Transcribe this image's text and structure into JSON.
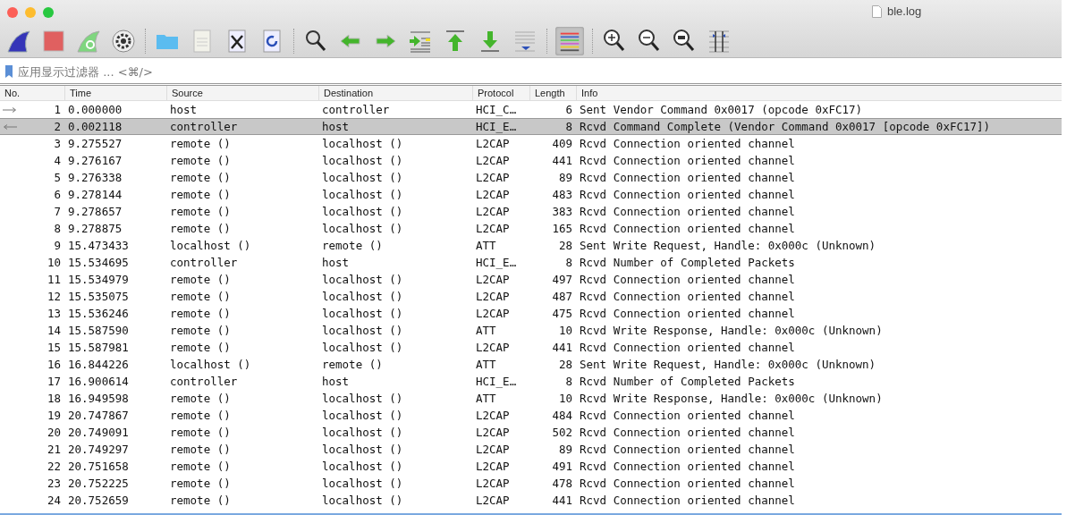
{
  "window": {
    "title": "ble.log"
  },
  "toolbar": {
    "colorize_on": true
  },
  "filter": {
    "placeholder": "应用显示过滤器 ... <⌘/>"
  },
  "table": {
    "columns": [
      "No.",
      "Time",
      "Source",
      "Destination",
      "Protocol",
      "Length",
      "Info"
    ],
    "rows": [
      {
        "cells": [
          "1",
          "0.000000",
          "host",
          "controller",
          "HCI_C…",
          "6",
          "Sent Vendor Command 0x0017 (opcode 0xFC17)"
        ],
        "selected": false,
        "kind": "sent"
      },
      {
        "cells": [
          "2",
          "0.002118",
          "controller",
          "host",
          "HCI_E…",
          "8",
          "Rcvd Command Complete (Vendor Command 0x0017 [opcode 0xFC17])"
        ],
        "selected": true,
        "kind": "received"
      },
      {
        "cells": [
          "3",
          "9.275527",
          "remote ()",
          "localhost ()",
          "L2CAP",
          "409",
          "Rcvd Connection oriented channel"
        ],
        "selected": false
      },
      {
        "cells": [
          "4",
          "9.276167",
          "remote ()",
          "localhost ()",
          "L2CAP",
          "441",
          "Rcvd Connection oriented channel"
        ],
        "selected": false
      },
      {
        "cells": [
          "5",
          "9.276338",
          "remote ()",
          "localhost ()",
          "L2CAP",
          "89",
          "Rcvd Connection oriented channel"
        ],
        "selected": false
      },
      {
        "cells": [
          "6",
          "9.278144",
          "remote ()",
          "localhost ()",
          "L2CAP",
          "483",
          "Rcvd Connection oriented channel"
        ],
        "selected": false
      },
      {
        "cells": [
          "7",
          "9.278657",
          "remote ()",
          "localhost ()",
          "L2CAP",
          "383",
          "Rcvd Connection oriented channel"
        ],
        "selected": false
      },
      {
        "cells": [
          "8",
          "9.278875",
          "remote ()",
          "localhost ()",
          "L2CAP",
          "165",
          "Rcvd Connection oriented channel"
        ],
        "selected": false
      },
      {
        "cells": [
          "9",
          "15.473433",
          "localhost ()",
          "remote ()",
          "ATT",
          "28",
          "Sent Write Request, Handle: 0x000c (Unknown)"
        ],
        "selected": false
      },
      {
        "cells": [
          "10",
          "15.534695",
          "controller",
          "host",
          "HCI_E…",
          "8",
          "Rcvd Number of Completed Packets"
        ],
        "selected": false
      },
      {
        "cells": [
          "11",
          "15.534979",
          "remote ()",
          "localhost ()",
          "L2CAP",
          "497",
          "Rcvd Connection oriented channel"
        ],
        "selected": false
      },
      {
        "cells": [
          "12",
          "15.535075",
          "remote ()",
          "localhost ()",
          "L2CAP",
          "487",
          "Rcvd Connection oriented channel"
        ],
        "selected": false
      },
      {
        "cells": [
          "13",
          "15.536246",
          "remote ()",
          "localhost ()",
          "L2CAP",
          "475",
          "Rcvd Connection oriented channel"
        ],
        "selected": false
      },
      {
        "cells": [
          "14",
          "15.587590",
          "remote ()",
          "localhost ()",
          "ATT",
          "10",
          "Rcvd Write Response, Handle: 0x000c (Unknown)"
        ],
        "selected": false
      },
      {
        "cells": [
          "15",
          "15.587981",
          "remote ()",
          "localhost ()",
          "L2CAP",
          "441",
          "Rcvd Connection oriented channel"
        ],
        "selected": false
      },
      {
        "cells": [
          "16",
          "16.844226",
          "localhost ()",
          "remote ()",
          "ATT",
          "28",
          "Sent Write Request, Handle: 0x000c (Unknown)"
        ],
        "selected": false
      },
      {
        "cells": [
          "17",
          "16.900614",
          "controller",
          "host",
          "HCI_E…",
          "8",
          "Rcvd Number of Completed Packets"
        ],
        "selected": false
      },
      {
        "cells": [
          "18",
          "16.949598",
          "remote ()",
          "localhost ()",
          "ATT",
          "10",
          "Rcvd Write Response, Handle: 0x000c (Unknown)"
        ],
        "selected": false
      },
      {
        "cells": [
          "19",
          "20.747867",
          "remote ()",
          "localhost ()",
          "L2CAP",
          "484",
          "Rcvd Connection oriented channel"
        ],
        "selected": false
      },
      {
        "cells": [
          "20",
          "20.749091",
          "remote ()",
          "localhost ()",
          "L2CAP",
          "502",
          "Rcvd Connection oriented channel"
        ],
        "selected": false
      },
      {
        "cells": [
          "21",
          "20.749297",
          "remote ()",
          "localhost ()",
          "L2CAP",
          "89",
          "Rcvd Connection oriented channel"
        ],
        "selected": false
      },
      {
        "cells": [
          "22",
          "20.751658",
          "remote ()",
          "localhost ()",
          "L2CAP",
          "491",
          "Rcvd Connection oriented channel"
        ],
        "selected": false
      },
      {
        "cells": [
          "23",
          "20.752225",
          "remote ()",
          "localhost ()",
          "L2CAP",
          "478",
          "Rcvd Connection oriented channel"
        ],
        "selected": false
      },
      {
        "cells": [
          "24",
          "20.752659",
          "remote ()",
          "localhost ()",
          "L2CAP",
          "441",
          "Rcvd Connection oriented channel"
        ],
        "selected": false
      }
    ]
  }
}
